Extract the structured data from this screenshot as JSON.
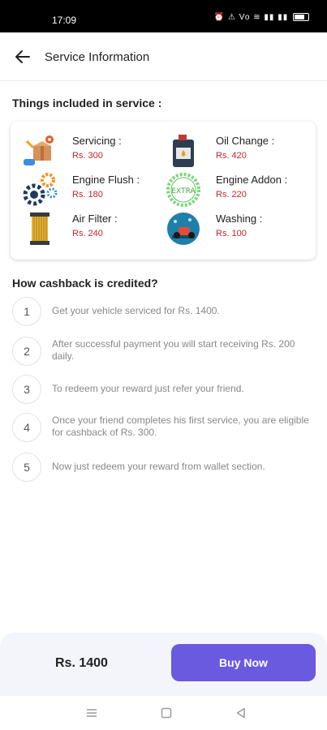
{
  "status_bar": {
    "time": "17:09",
    "icons": "⏰ ⚠ Vo ≋ ▮▮ ▮▮"
  },
  "header": {
    "title": "Service Information"
  },
  "services": {
    "heading": "Things included in service :",
    "items": [
      {
        "name": "Servicing :",
        "price": "Rs. 300",
        "icon": "box-wrench-icon"
      },
      {
        "name": "Oil Change :",
        "price": "Rs. 420",
        "icon": "oil-can-icon"
      },
      {
        "name": "Engine Flush :",
        "price": "Rs. 180",
        "icon": "gears-icon"
      },
      {
        "name": "Engine Addon :",
        "price": "Rs. 220",
        "icon": "extra-badge-icon",
        "badge_text": "EXTRA"
      },
      {
        "name": "Air Filter :",
        "price": "Rs. 240",
        "icon": "air-filter-icon"
      },
      {
        "name": "Washing :",
        "price": "Rs. 100",
        "icon": "washing-icon"
      }
    ]
  },
  "cashback": {
    "heading": "How cashback is credited?",
    "steps": [
      {
        "num": "1",
        "text": "Get your vehicle serviced for Rs. 1400."
      },
      {
        "num": "2",
        "text": "After successful payment you will start receiving Rs. 200 daily."
      },
      {
        "num": "3",
        "text": "To redeem your reward just refer your friend."
      },
      {
        "num": "4",
        "text": "Once your friend completes his first service, you are eligible for cashback of Rs. 300."
      },
      {
        "num": "5",
        "text": "Now just redeem your reward from wallet section."
      }
    ]
  },
  "footer": {
    "total": "Rs. 1400",
    "buy_label": "Buy Now"
  },
  "colors": {
    "accent": "#6a5ae0",
    "price": "#c0262d",
    "status_bar": "#000000"
  }
}
